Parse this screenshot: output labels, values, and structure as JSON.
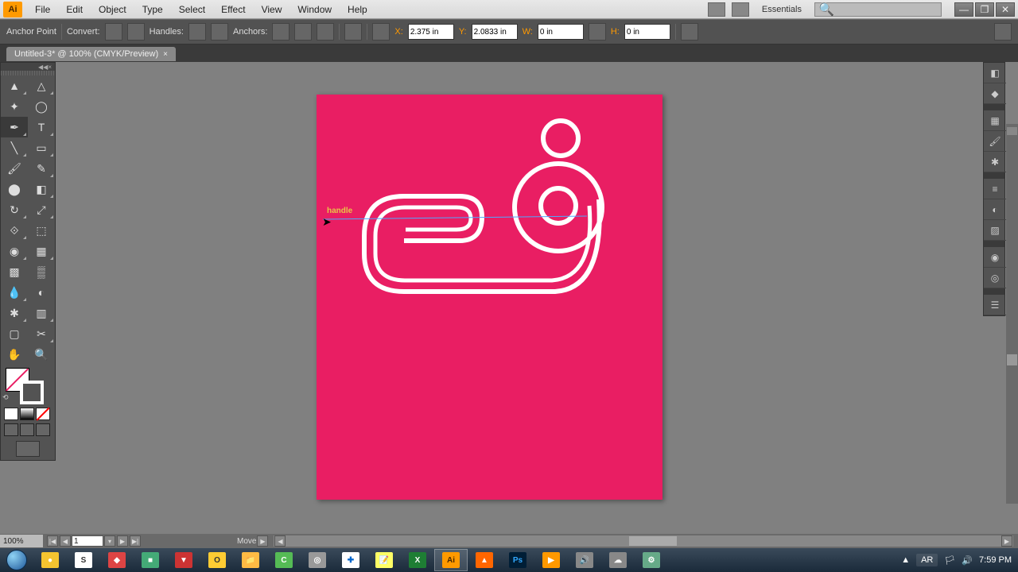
{
  "app": {
    "icon_text": "Ai"
  },
  "menu": {
    "items": [
      "File",
      "Edit",
      "Object",
      "Type",
      "Select",
      "Effect",
      "View",
      "Window",
      "Help"
    ],
    "workspace": "Essentials",
    "search_placeholder": ""
  },
  "controlbar": {
    "mode_label": "Anchor Point",
    "convert_label": "Convert:",
    "handles_label": "Handles:",
    "anchors_label": "Anchors:",
    "x_label": "X:",
    "x_value": "2.375 in",
    "y_label": "Y:",
    "y_value": "2.0833 in",
    "w_label": "W:",
    "w_value": "0 in",
    "h_label": "H:",
    "h_value": "0 in"
  },
  "tab": {
    "title": "Untitled-3* @ 100% (CMYK/Preview)",
    "close": "×"
  },
  "canvas": {
    "tooltip": "handle"
  },
  "status": {
    "zoom": "100%",
    "page": "1",
    "action": "Move"
  },
  "taskbar": {
    "lang": "AR",
    "time": "7:59 PM"
  },
  "colors": {
    "artboard_bg": "#e91e63",
    "stroke": "#ffffff"
  }
}
